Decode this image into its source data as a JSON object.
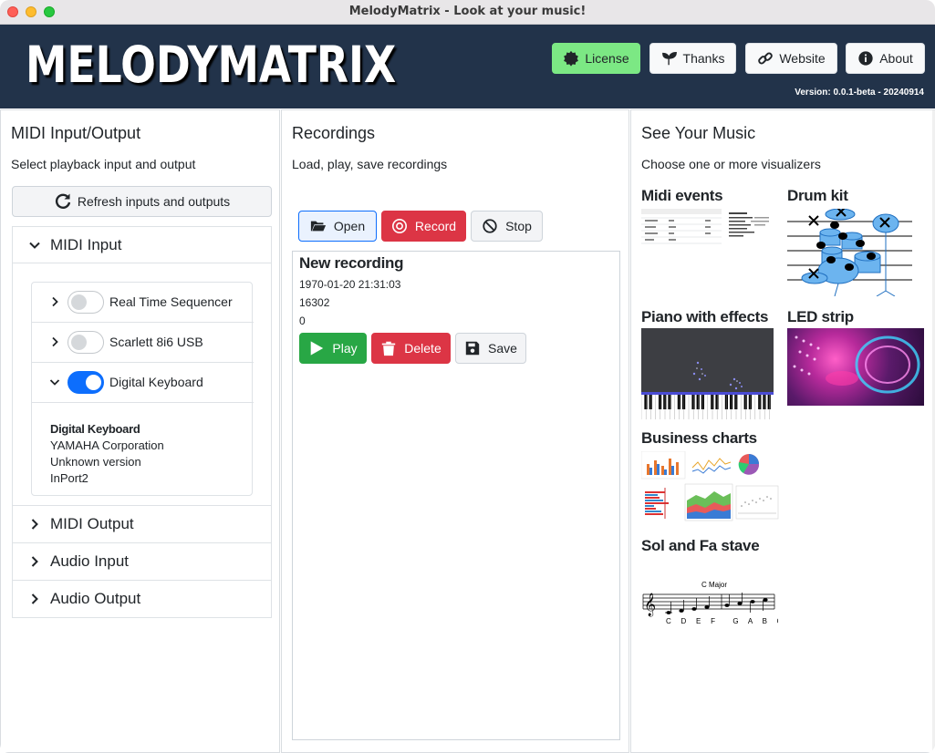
{
  "window": {
    "title": "MelodyMatrix - Look at your music!"
  },
  "header": {
    "logo": "MELODYMATRIX",
    "buttons": {
      "license": "License",
      "thanks": "Thanks",
      "website": "Website",
      "about": "About"
    },
    "version": "Version: 0.0.1-beta - 20240914"
  },
  "midi_io": {
    "title": "MIDI Input/Output",
    "subtitle": "Select playback input and output",
    "refresh_label": "Refresh inputs and outputs",
    "midi_input": {
      "label": "MIDI Input",
      "devices": [
        {
          "name": "Real Time Sequencer",
          "enabled": false
        },
        {
          "name": "Scarlett 8i6 USB",
          "enabled": false
        },
        {
          "name": "Digital Keyboard",
          "enabled": true
        }
      ],
      "details": {
        "name": "Digital Keyboard",
        "vendor": "YAMAHA Corporation",
        "version": "Unknown version",
        "port": "InPort2"
      }
    },
    "midi_output": {
      "label": "MIDI Output"
    },
    "audio_input": {
      "label": "Audio Input"
    },
    "audio_output": {
      "label": "Audio Output"
    }
  },
  "recordings": {
    "title": "Recordings",
    "subtitle": "Load, play, save recordings",
    "toolbar": {
      "open": "Open",
      "record": "Record",
      "stop": "Stop"
    },
    "items": [
      {
        "name": "New recording",
        "date": "1970-01-20 21:31:03",
        "value1": "16302",
        "value2": "0",
        "actions": {
          "play": "Play",
          "delete": "Delete",
          "save": "Save"
        }
      }
    ]
  },
  "visualizers": {
    "title": "See Your Music",
    "subtitle": "Choose one or more visualizers",
    "items": {
      "midi_events": "Midi events",
      "drum_kit": "Drum kit",
      "piano": "Piano with effects",
      "led_strip": "LED strip",
      "business": "Business charts",
      "stave": "Sol and Fa stave"
    },
    "stave_key": "C Major",
    "stave_notes": "C  D  E  F    G  A  B  C"
  },
  "colors": {
    "header_bg": "#22334a",
    "license_green": "#7ce884",
    "primary_blue": "#0d6efd",
    "danger_red": "#dc3545",
    "success_green": "#28a745"
  }
}
